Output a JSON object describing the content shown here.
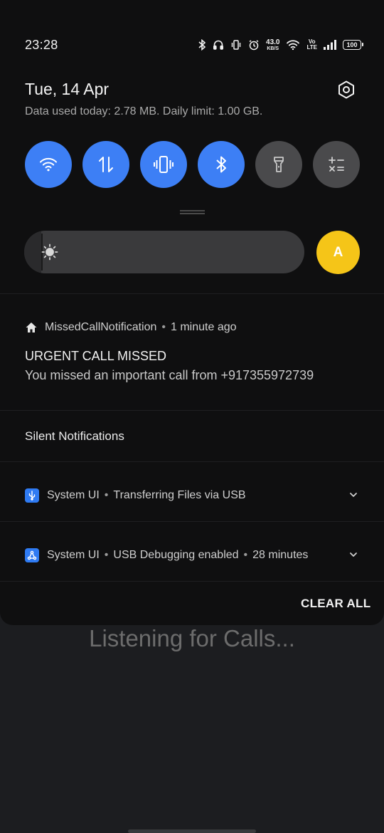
{
  "status_bar": {
    "time": "23:28",
    "net_speed_value": "43.0",
    "net_speed_unit": "KB/S",
    "volte_top": "Vo",
    "volte_bottom": "LTE",
    "battery": "100",
    "icons": [
      "bluetooth-icon",
      "headset-icon",
      "vibrate-icon",
      "alarm-icon",
      "wifi-icon",
      "signal-icon",
      "battery-icon"
    ]
  },
  "header": {
    "date": "Tue, 14 Apr",
    "data_used": "Data used today: 2.78 MB. Daily limit: 1.00 GB."
  },
  "quick_tiles": [
    {
      "name": "wifi",
      "icon": "wifi-icon",
      "state": "on"
    },
    {
      "name": "mobile-data",
      "icon": "mobile-data-icon",
      "state": "on"
    },
    {
      "name": "vibrate",
      "icon": "vibrate-icon",
      "state": "on"
    },
    {
      "name": "bluetooth",
      "icon": "bluetooth-icon",
      "state": "on"
    },
    {
      "name": "flashlight",
      "icon": "flashlight-icon",
      "state": "off"
    },
    {
      "name": "calculator",
      "icon": "calculator-icon",
      "state": "off"
    }
  ],
  "brightness": {
    "level": 0.06,
    "auto_label": "A"
  },
  "notification": {
    "app": "MissedCallNotification",
    "separator": "•",
    "time": "1 minute ago",
    "title": "URGENT CALL MISSED",
    "body": "You missed an important call from +917355972739"
  },
  "silent": {
    "label": "Silent Notifications",
    "items": [
      {
        "app": "System UI",
        "text": "Transferring Files via USB",
        "time": "",
        "icon": "usb-icon"
      },
      {
        "app": "System UI",
        "text": "USB Debugging enabled",
        "time": "28 minutes",
        "icon": "debug-icon"
      }
    ]
  },
  "clear_all": "CLEAR ALL",
  "background_text": "Listening for Calls...",
  "colors": {
    "tile_on": "#3d7ff5",
    "tile_off": "#4a4a4c",
    "auto_brightness": "#f5c518",
    "shade_bg": "#0f0f10",
    "app_bg": "#1c1d20"
  }
}
